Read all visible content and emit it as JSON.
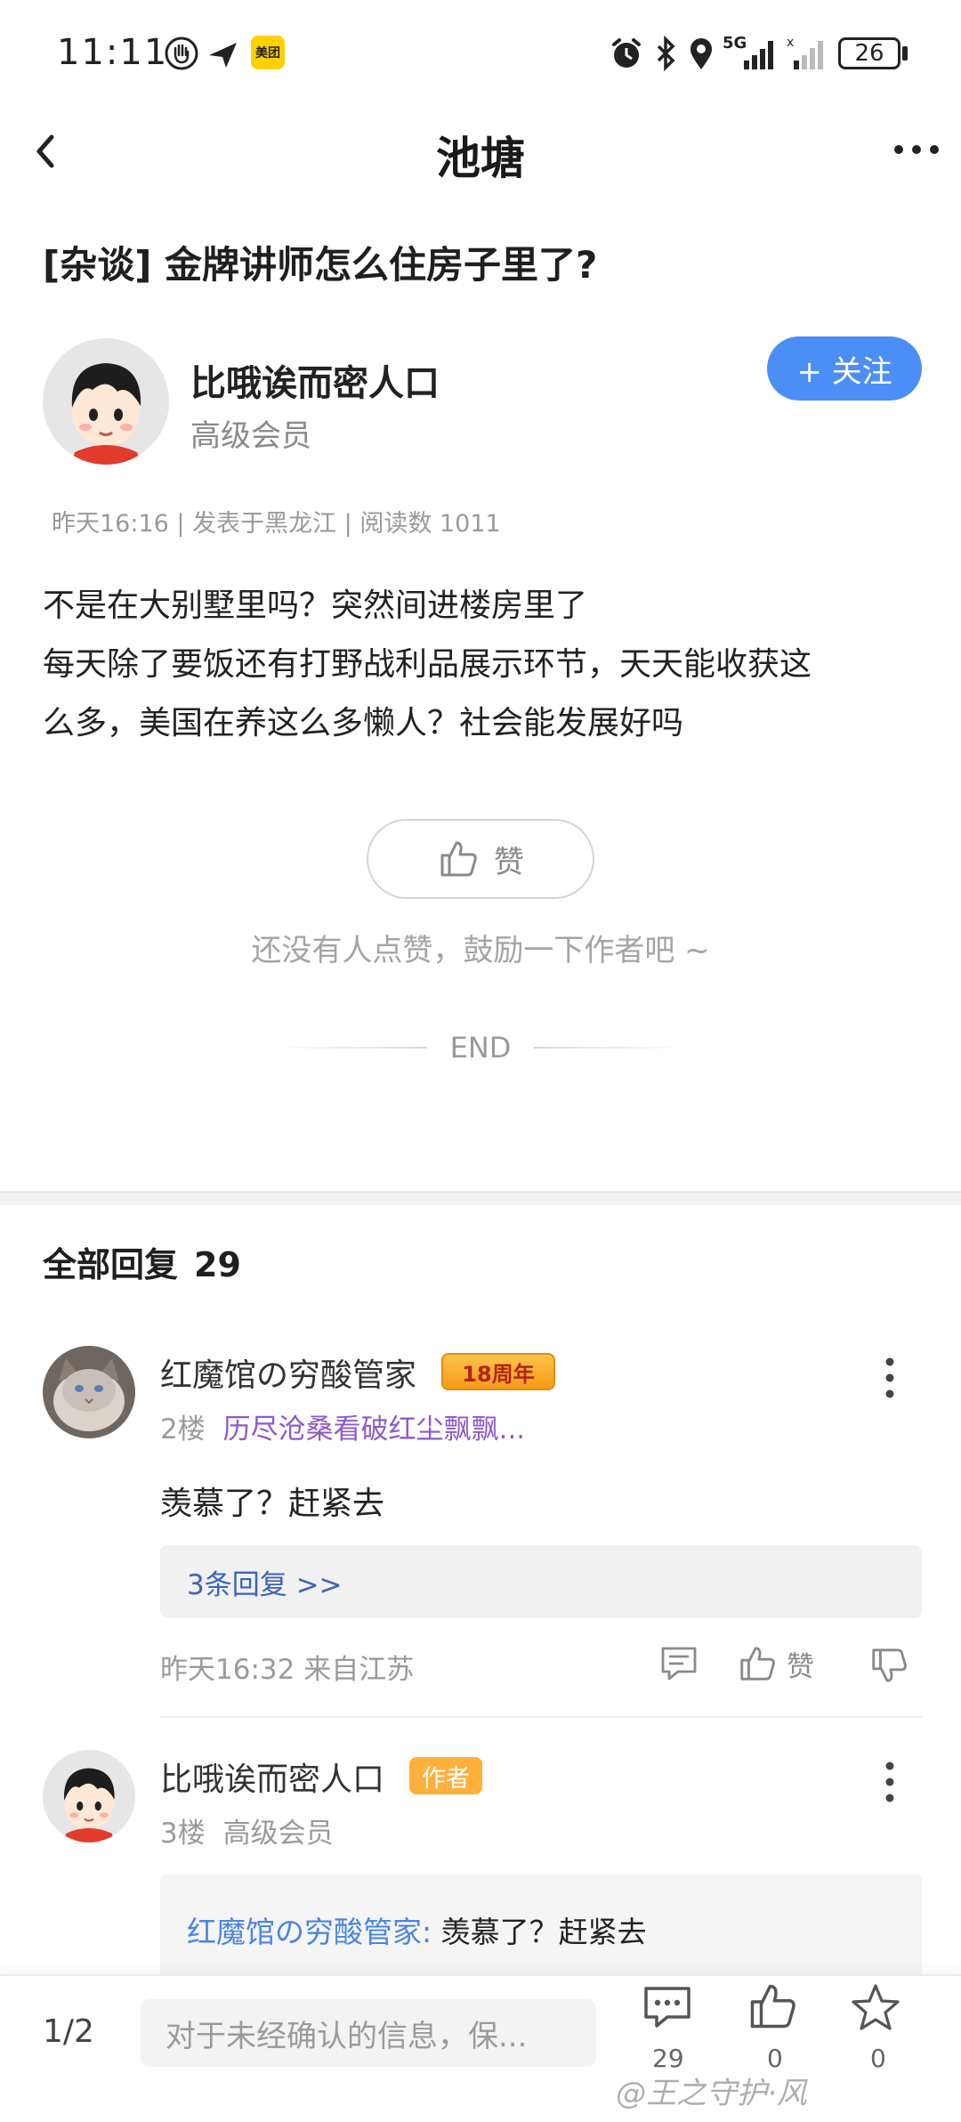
{
  "status_bar": {
    "time": "11:11",
    "app_badge": "美团",
    "network": "5G",
    "battery": "26"
  },
  "header": {
    "title": "池塘"
  },
  "post": {
    "title": "[杂谈] 金牌讲师怎么住房子里了?",
    "author": {
      "name": "比哦诶而密人口",
      "level": "高级会员"
    },
    "follow_label": "+ 关注",
    "meta": "昨天16:16 | 发表于黑龙江 | 阅读数 1011",
    "body_lines": [
      "不是在大别墅里吗？突然间进楼房里了",
      "每天除了要饭还有打野战利品展示环节，天天能收获这",
      "么多，美国在养这么多懒人？社会能发展好吗"
    ],
    "like_label": "赞",
    "like_hint": "还没有人点赞，鼓励一下作者吧 ~",
    "end_label": "END"
  },
  "replies": {
    "heading": "全部回复",
    "count": "29",
    "items": [
      {
        "user": "红魔馆の穷酸管家",
        "badge": "18周年",
        "floor": "2楼",
        "signature": "历尽沧桑看破红尘飘飘...",
        "text": "羡慕了？赶紧去",
        "sub_replies": "3条回复 >>",
        "time": "昨天16:32 来自江苏",
        "like_label": "赞"
      },
      {
        "user": "比哦诶而密人口",
        "author_tag": "作者",
        "floor": "3楼",
        "level": "高级会员",
        "quote_user": "红魔馆の穷酸管家:",
        "quote_text": "羡慕了？赶紧去"
      }
    ]
  },
  "bottom_bar": {
    "page_indicator": "1/2",
    "input_placeholder": "对于未经确认的信息，保...",
    "comment_count": "29",
    "like_count": "0",
    "fav_count": "0"
  },
  "watermark": "@王之守护·风",
  "colors": {
    "accent": "#4b8ef5",
    "link": "#4a85e3",
    "author_tag": "#ffb03c",
    "signature": "#8e5ac7"
  }
}
